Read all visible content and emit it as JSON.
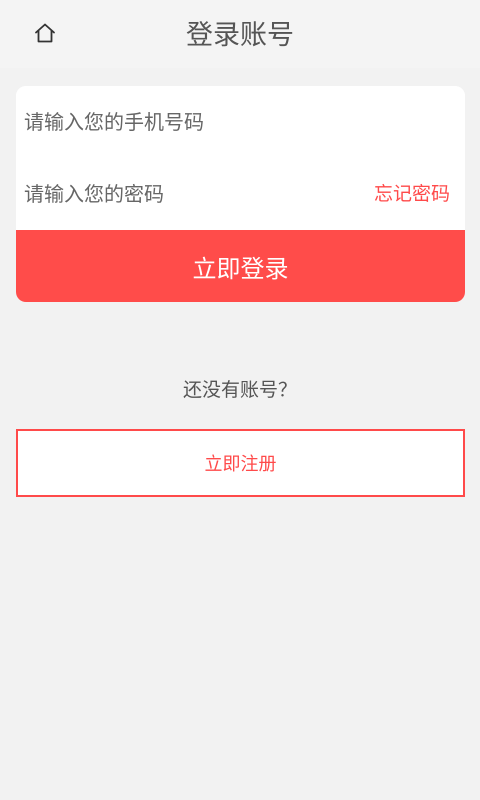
{
  "header": {
    "home_icon": "home-icon",
    "title": "登录账号"
  },
  "login_form": {
    "phone_placeholder": "请输入您的手机号码",
    "phone_value": "",
    "password_placeholder": "请输入您的密码",
    "password_value": "",
    "forgot_password_label": "忘记密码",
    "login_button_label": "立即登录"
  },
  "register": {
    "prompt": "还没有账号？",
    "register_button_label": "立即注册"
  },
  "colors": {
    "accent": "#ff4c4a",
    "background": "#f2f2f2",
    "text": "#555555"
  }
}
